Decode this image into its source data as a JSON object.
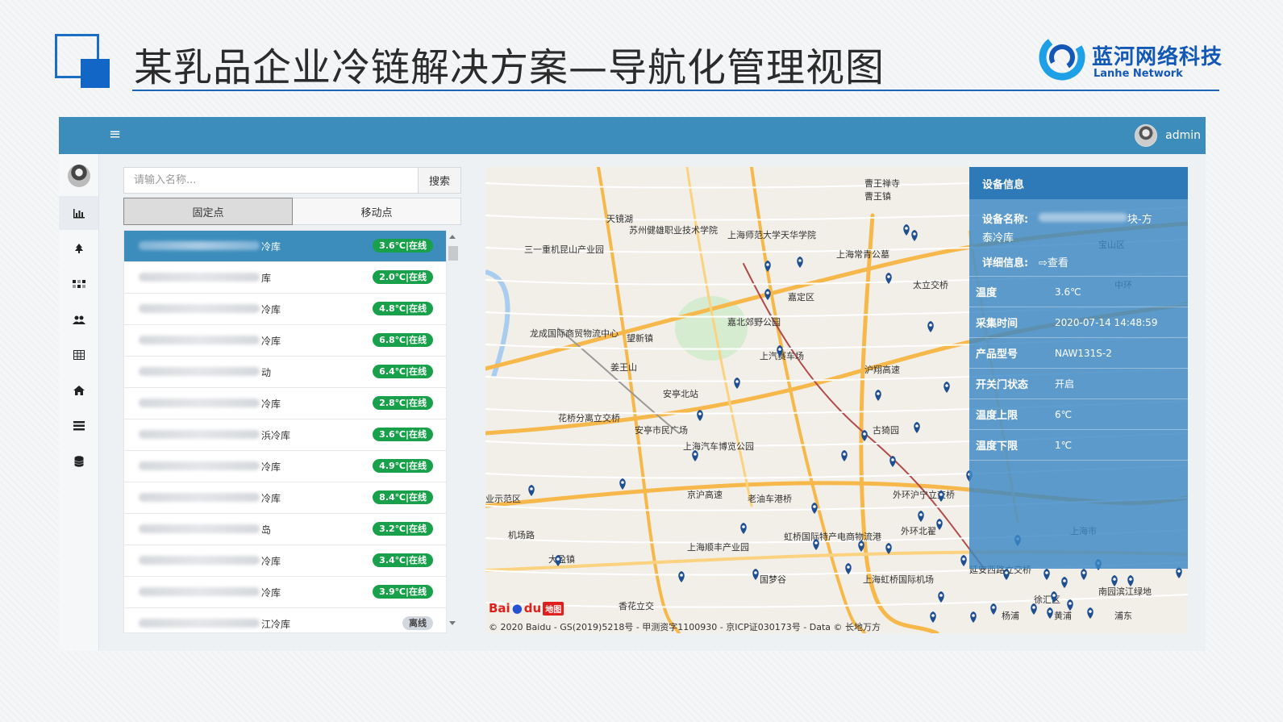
{
  "slide": {
    "title": "某乳品企业冷链解决方案—导航化管理视图",
    "brand_cn": "蓝河网络科技",
    "brand_en": "Lanhe Network",
    "accent": "#1266c6"
  },
  "topbar": {
    "menu_icon": "hamburger-icon",
    "user_name": "admin",
    "color": "#3c8dbc"
  },
  "sidebar": {
    "items": [
      {
        "icon": "avatar"
      },
      {
        "icon": "bar-chart-icon"
      },
      {
        "icon": "tree-icon"
      },
      {
        "icon": "grid-icon"
      },
      {
        "icon": "users-icon"
      },
      {
        "icon": "table-icon"
      },
      {
        "icon": "home-icon"
      },
      {
        "icon": "list-icon"
      },
      {
        "icon": "database-icon"
      }
    ]
  },
  "search": {
    "placeholder": "请输入名称...",
    "button_label": "搜索"
  },
  "tabs": [
    {
      "label": "固定点",
      "active": true
    },
    {
      "label": "移动点",
      "active": false
    }
  ],
  "device_list": [
    {
      "name_visible": "冷库",
      "status": "3.6℃|在线",
      "online": true,
      "selected": true
    },
    {
      "name_visible": "库",
      "status": "2.0℃|在线",
      "online": true
    },
    {
      "name_visible": "冷库",
      "status": "4.8℃|在线",
      "online": true
    },
    {
      "name_visible": "冷库",
      "status": "6.8℃|在线",
      "online": true
    },
    {
      "name_visible": "动",
      "status": "6.4℃|在线",
      "online": true
    },
    {
      "name_visible": "冷库",
      "status": "2.8℃|在线",
      "online": true
    },
    {
      "name_visible": "浜冷库",
      "status": "3.6℃|在线",
      "online": true
    },
    {
      "name_visible": "冷库",
      "status": "4.9℃|在线",
      "online": true
    },
    {
      "name_visible": "冷库",
      "status": "8.4℃|在线",
      "online": true
    },
    {
      "name_visible": "岛",
      "status": "3.2℃|在线",
      "online": true
    },
    {
      "name_visible": "冷库",
      "status": "3.4℃|在线",
      "online": true
    },
    {
      "name_visible": "冷库",
      "status": "3.9℃|在线",
      "online": true
    },
    {
      "name_visible": "江冷库",
      "status": "离线",
      "online": false
    }
  ],
  "device_info": {
    "header": "设备信息",
    "name_label": "设备名称:",
    "name_suffix": "块-方",
    "name_line2": "泰冷库",
    "detail_label": "详细信息:",
    "detail_link": "⇨查看",
    "rows": [
      {
        "label": "温度",
        "value": "3.6℃"
      },
      {
        "label": "采集时间",
        "value": "2020-07-14 14:48:59"
      },
      {
        "label": "产品型号",
        "value": "NAW131S-2"
      },
      {
        "label": "开关门状态",
        "value": "开启"
      },
      {
        "label": "温度上限",
        "value": "6℃"
      },
      {
        "label": "温度下限",
        "value": "1℃"
      }
    ]
  },
  "map": {
    "labels": [
      "天镜湖",
      "苏州健雄职业技术学院",
      "上海师范大学天华学院",
      "曹王禅寺",
      "曹王镇",
      "三一重机昆山产业园",
      "嘉定区",
      "太立交桥",
      "上海常青公墓",
      "嘉北郊野公园",
      "龙成国际商贸物流中心",
      "望新镇",
      "上汽赛车场",
      "沪翔高速",
      "姜王山",
      "安亭北站",
      "古猗园",
      "花桥分离立交桥",
      "安亭市民广场",
      "上海汽车博览公园",
      "京沪高速",
      "老油车港桥",
      "外环沪宁立交桥",
      "外环北翟",
      "上海顺丰产业园",
      "虹桥国际特产电商物流港",
      "国梦谷",
      "上海虹桥国际机场",
      "延安西路立交桥",
      "徐汇区",
      "上海市",
      "南园滨江绿地",
      "香花立交",
      "黄浦",
      "浦东",
      "宝山区",
      "中环",
      "业示范区",
      "机场路",
      "大盈镇",
      "杨浦"
    ],
    "copyright": "© 2020 Baidu - GS(2019)5218号 - 甲测资字1100930 - 京ICP证030173号 - Data © 长地万方",
    "logo_a": "Bai",
    "logo_b": "du",
    "logo_c": "地图"
  }
}
